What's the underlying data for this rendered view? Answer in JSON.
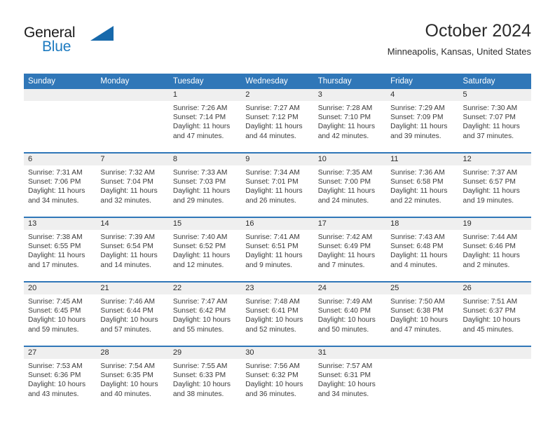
{
  "logo": {
    "word_top": "General",
    "word_bottom": "Blue",
    "triangle_color": "#1769ab",
    "blue_text_color": "#1c7ac0"
  },
  "header": {
    "title": "October 2024",
    "subtitle": "Minneapolis, Kansas, United States"
  },
  "theme": {
    "header_blue": "#3077b8",
    "daynum_band": "#efefef",
    "text": "#3a3a3a"
  },
  "calendar": {
    "weekday_headers": [
      "Sunday",
      "Monday",
      "Tuesday",
      "Wednesday",
      "Thursday",
      "Friday",
      "Saturday"
    ],
    "labels": {
      "sunrise": "Sunrise:",
      "sunset": "Sunset:",
      "daylight": "Daylight:"
    },
    "weeks": [
      [
        {
          "empty": true
        },
        {
          "empty": true
        },
        {
          "day": "1",
          "sunrise": "Sunrise: 7:26 AM",
          "sunset": "Sunset: 7:14 PM",
          "daylight1": "Daylight: 11 hours",
          "daylight2": "and 47 minutes."
        },
        {
          "day": "2",
          "sunrise": "Sunrise: 7:27 AM",
          "sunset": "Sunset: 7:12 PM",
          "daylight1": "Daylight: 11 hours",
          "daylight2": "and 44 minutes."
        },
        {
          "day": "3",
          "sunrise": "Sunrise: 7:28 AM",
          "sunset": "Sunset: 7:10 PM",
          "daylight1": "Daylight: 11 hours",
          "daylight2": "and 42 minutes."
        },
        {
          "day": "4",
          "sunrise": "Sunrise: 7:29 AM",
          "sunset": "Sunset: 7:09 PM",
          "daylight1": "Daylight: 11 hours",
          "daylight2": "and 39 minutes."
        },
        {
          "day": "5",
          "sunrise": "Sunrise: 7:30 AM",
          "sunset": "Sunset: 7:07 PM",
          "daylight1": "Daylight: 11 hours",
          "daylight2": "and 37 minutes."
        }
      ],
      [
        {
          "day": "6",
          "sunrise": "Sunrise: 7:31 AM",
          "sunset": "Sunset: 7:06 PM",
          "daylight1": "Daylight: 11 hours",
          "daylight2": "and 34 minutes."
        },
        {
          "day": "7",
          "sunrise": "Sunrise: 7:32 AM",
          "sunset": "Sunset: 7:04 PM",
          "daylight1": "Daylight: 11 hours",
          "daylight2": "and 32 minutes."
        },
        {
          "day": "8",
          "sunrise": "Sunrise: 7:33 AM",
          "sunset": "Sunset: 7:03 PM",
          "daylight1": "Daylight: 11 hours",
          "daylight2": "and 29 minutes."
        },
        {
          "day": "9",
          "sunrise": "Sunrise: 7:34 AM",
          "sunset": "Sunset: 7:01 PM",
          "daylight1": "Daylight: 11 hours",
          "daylight2": "and 26 minutes."
        },
        {
          "day": "10",
          "sunrise": "Sunrise: 7:35 AM",
          "sunset": "Sunset: 7:00 PM",
          "daylight1": "Daylight: 11 hours",
          "daylight2": "and 24 minutes."
        },
        {
          "day": "11",
          "sunrise": "Sunrise: 7:36 AM",
          "sunset": "Sunset: 6:58 PM",
          "daylight1": "Daylight: 11 hours",
          "daylight2": "and 22 minutes."
        },
        {
          "day": "12",
          "sunrise": "Sunrise: 7:37 AM",
          "sunset": "Sunset: 6:57 PM",
          "daylight1": "Daylight: 11 hours",
          "daylight2": "and 19 minutes."
        }
      ],
      [
        {
          "day": "13",
          "sunrise": "Sunrise: 7:38 AM",
          "sunset": "Sunset: 6:55 PM",
          "daylight1": "Daylight: 11 hours",
          "daylight2": "and 17 minutes."
        },
        {
          "day": "14",
          "sunrise": "Sunrise: 7:39 AM",
          "sunset": "Sunset: 6:54 PM",
          "daylight1": "Daylight: 11 hours",
          "daylight2": "and 14 minutes."
        },
        {
          "day": "15",
          "sunrise": "Sunrise: 7:40 AM",
          "sunset": "Sunset: 6:52 PM",
          "daylight1": "Daylight: 11 hours",
          "daylight2": "and 12 minutes."
        },
        {
          "day": "16",
          "sunrise": "Sunrise: 7:41 AM",
          "sunset": "Sunset: 6:51 PM",
          "daylight1": "Daylight: 11 hours",
          "daylight2": "and 9 minutes."
        },
        {
          "day": "17",
          "sunrise": "Sunrise: 7:42 AM",
          "sunset": "Sunset: 6:49 PM",
          "daylight1": "Daylight: 11 hours",
          "daylight2": "and 7 minutes."
        },
        {
          "day": "18",
          "sunrise": "Sunrise: 7:43 AM",
          "sunset": "Sunset: 6:48 PM",
          "daylight1": "Daylight: 11 hours",
          "daylight2": "and 4 minutes."
        },
        {
          "day": "19",
          "sunrise": "Sunrise: 7:44 AM",
          "sunset": "Sunset: 6:46 PM",
          "daylight1": "Daylight: 11 hours",
          "daylight2": "and 2 minutes."
        }
      ],
      [
        {
          "day": "20",
          "sunrise": "Sunrise: 7:45 AM",
          "sunset": "Sunset: 6:45 PM",
          "daylight1": "Daylight: 10 hours",
          "daylight2": "and 59 minutes."
        },
        {
          "day": "21",
          "sunrise": "Sunrise: 7:46 AM",
          "sunset": "Sunset: 6:44 PM",
          "daylight1": "Daylight: 10 hours",
          "daylight2": "and 57 minutes."
        },
        {
          "day": "22",
          "sunrise": "Sunrise: 7:47 AM",
          "sunset": "Sunset: 6:42 PM",
          "daylight1": "Daylight: 10 hours",
          "daylight2": "and 55 minutes."
        },
        {
          "day": "23",
          "sunrise": "Sunrise: 7:48 AM",
          "sunset": "Sunset: 6:41 PM",
          "daylight1": "Daylight: 10 hours",
          "daylight2": "and 52 minutes."
        },
        {
          "day": "24",
          "sunrise": "Sunrise: 7:49 AM",
          "sunset": "Sunset: 6:40 PM",
          "daylight1": "Daylight: 10 hours",
          "daylight2": "and 50 minutes."
        },
        {
          "day": "25",
          "sunrise": "Sunrise: 7:50 AM",
          "sunset": "Sunset: 6:38 PM",
          "daylight1": "Daylight: 10 hours",
          "daylight2": "and 47 minutes."
        },
        {
          "day": "26",
          "sunrise": "Sunrise: 7:51 AM",
          "sunset": "Sunset: 6:37 PM",
          "daylight1": "Daylight: 10 hours",
          "daylight2": "and 45 minutes."
        }
      ],
      [
        {
          "day": "27",
          "sunrise": "Sunrise: 7:53 AM",
          "sunset": "Sunset: 6:36 PM",
          "daylight1": "Daylight: 10 hours",
          "daylight2": "and 43 minutes."
        },
        {
          "day": "28",
          "sunrise": "Sunrise: 7:54 AM",
          "sunset": "Sunset: 6:35 PM",
          "daylight1": "Daylight: 10 hours",
          "daylight2": "and 40 minutes."
        },
        {
          "day": "29",
          "sunrise": "Sunrise: 7:55 AM",
          "sunset": "Sunset: 6:33 PM",
          "daylight1": "Daylight: 10 hours",
          "daylight2": "and 38 minutes."
        },
        {
          "day": "30",
          "sunrise": "Sunrise: 7:56 AM",
          "sunset": "Sunset: 6:32 PM",
          "daylight1": "Daylight: 10 hours",
          "daylight2": "and 36 minutes."
        },
        {
          "day": "31",
          "sunrise": "Sunrise: 7:57 AM",
          "sunset": "Sunset: 6:31 PM",
          "daylight1": "Daylight: 10 hours",
          "daylight2": "and 34 minutes."
        },
        {
          "empty": true
        },
        {
          "empty": true
        }
      ]
    ]
  }
}
